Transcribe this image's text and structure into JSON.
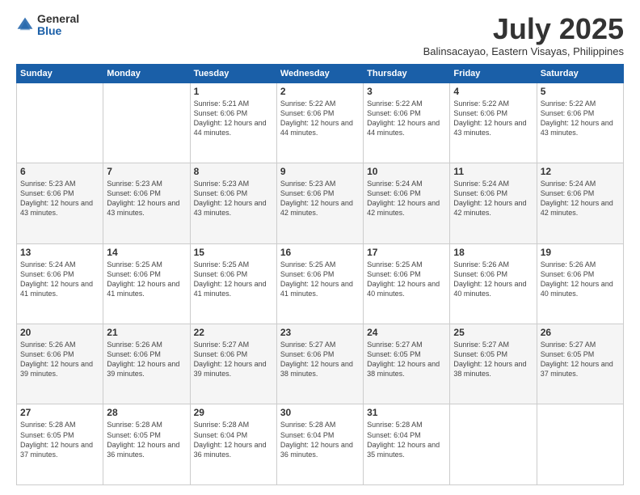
{
  "logo": {
    "general": "General",
    "blue": "Blue"
  },
  "header": {
    "month": "July 2025",
    "location": "Balinsacayao, Eastern Visayas, Philippines"
  },
  "weekdays": [
    "Sunday",
    "Monday",
    "Tuesday",
    "Wednesday",
    "Thursday",
    "Friday",
    "Saturday"
  ],
  "weeks": [
    [
      {
        "day": "",
        "sunrise": "",
        "sunset": "",
        "daylight": ""
      },
      {
        "day": "",
        "sunrise": "",
        "sunset": "",
        "daylight": ""
      },
      {
        "day": "1",
        "sunrise": "Sunrise: 5:21 AM",
        "sunset": "Sunset: 6:06 PM",
        "daylight": "Daylight: 12 hours and 44 minutes."
      },
      {
        "day": "2",
        "sunrise": "Sunrise: 5:22 AM",
        "sunset": "Sunset: 6:06 PM",
        "daylight": "Daylight: 12 hours and 44 minutes."
      },
      {
        "day": "3",
        "sunrise": "Sunrise: 5:22 AM",
        "sunset": "Sunset: 6:06 PM",
        "daylight": "Daylight: 12 hours and 44 minutes."
      },
      {
        "day": "4",
        "sunrise": "Sunrise: 5:22 AM",
        "sunset": "Sunset: 6:06 PM",
        "daylight": "Daylight: 12 hours and 43 minutes."
      },
      {
        "day": "5",
        "sunrise": "Sunrise: 5:22 AM",
        "sunset": "Sunset: 6:06 PM",
        "daylight": "Daylight: 12 hours and 43 minutes."
      }
    ],
    [
      {
        "day": "6",
        "sunrise": "Sunrise: 5:23 AM",
        "sunset": "Sunset: 6:06 PM",
        "daylight": "Daylight: 12 hours and 43 minutes."
      },
      {
        "day": "7",
        "sunrise": "Sunrise: 5:23 AM",
        "sunset": "Sunset: 6:06 PM",
        "daylight": "Daylight: 12 hours and 43 minutes."
      },
      {
        "day": "8",
        "sunrise": "Sunrise: 5:23 AM",
        "sunset": "Sunset: 6:06 PM",
        "daylight": "Daylight: 12 hours and 43 minutes."
      },
      {
        "day": "9",
        "sunrise": "Sunrise: 5:23 AM",
        "sunset": "Sunset: 6:06 PM",
        "daylight": "Daylight: 12 hours and 42 minutes."
      },
      {
        "day": "10",
        "sunrise": "Sunrise: 5:24 AM",
        "sunset": "Sunset: 6:06 PM",
        "daylight": "Daylight: 12 hours and 42 minutes."
      },
      {
        "day": "11",
        "sunrise": "Sunrise: 5:24 AM",
        "sunset": "Sunset: 6:06 PM",
        "daylight": "Daylight: 12 hours and 42 minutes."
      },
      {
        "day": "12",
        "sunrise": "Sunrise: 5:24 AM",
        "sunset": "Sunset: 6:06 PM",
        "daylight": "Daylight: 12 hours and 42 minutes."
      }
    ],
    [
      {
        "day": "13",
        "sunrise": "Sunrise: 5:24 AM",
        "sunset": "Sunset: 6:06 PM",
        "daylight": "Daylight: 12 hours and 41 minutes."
      },
      {
        "day": "14",
        "sunrise": "Sunrise: 5:25 AM",
        "sunset": "Sunset: 6:06 PM",
        "daylight": "Daylight: 12 hours and 41 minutes."
      },
      {
        "day": "15",
        "sunrise": "Sunrise: 5:25 AM",
        "sunset": "Sunset: 6:06 PM",
        "daylight": "Daylight: 12 hours and 41 minutes."
      },
      {
        "day": "16",
        "sunrise": "Sunrise: 5:25 AM",
        "sunset": "Sunset: 6:06 PM",
        "daylight": "Daylight: 12 hours and 41 minutes."
      },
      {
        "day": "17",
        "sunrise": "Sunrise: 5:25 AM",
        "sunset": "Sunset: 6:06 PM",
        "daylight": "Daylight: 12 hours and 40 minutes."
      },
      {
        "day": "18",
        "sunrise": "Sunrise: 5:26 AM",
        "sunset": "Sunset: 6:06 PM",
        "daylight": "Daylight: 12 hours and 40 minutes."
      },
      {
        "day": "19",
        "sunrise": "Sunrise: 5:26 AM",
        "sunset": "Sunset: 6:06 PM",
        "daylight": "Daylight: 12 hours and 40 minutes."
      }
    ],
    [
      {
        "day": "20",
        "sunrise": "Sunrise: 5:26 AM",
        "sunset": "Sunset: 6:06 PM",
        "daylight": "Daylight: 12 hours and 39 minutes."
      },
      {
        "day": "21",
        "sunrise": "Sunrise: 5:26 AM",
        "sunset": "Sunset: 6:06 PM",
        "daylight": "Daylight: 12 hours and 39 minutes."
      },
      {
        "day": "22",
        "sunrise": "Sunrise: 5:27 AM",
        "sunset": "Sunset: 6:06 PM",
        "daylight": "Daylight: 12 hours and 39 minutes."
      },
      {
        "day": "23",
        "sunrise": "Sunrise: 5:27 AM",
        "sunset": "Sunset: 6:06 PM",
        "daylight": "Daylight: 12 hours and 38 minutes."
      },
      {
        "day": "24",
        "sunrise": "Sunrise: 5:27 AM",
        "sunset": "Sunset: 6:05 PM",
        "daylight": "Daylight: 12 hours and 38 minutes."
      },
      {
        "day": "25",
        "sunrise": "Sunrise: 5:27 AM",
        "sunset": "Sunset: 6:05 PM",
        "daylight": "Daylight: 12 hours and 38 minutes."
      },
      {
        "day": "26",
        "sunrise": "Sunrise: 5:27 AM",
        "sunset": "Sunset: 6:05 PM",
        "daylight": "Daylight: 12 hours and 37 minutes."
      }
    ],
    [
      {
        "day": "27",
        "sunrise": "Sunrise: 5:28 AM",
        "sunset": "Sunset: 6:05 PM",
        "daylight": "Daylight: 12 hours and 37 minutes."
      },
      {
        "day": "28",
        "sunrise": "Sunrise: 5:28 AM",
        "sunset": "Sunset: 6:05 PM",
        "daylight": "Daylight: 12 hours and 36 minutes."
      },
      {
        "day": "29",
        "sunrise": "Sunrise: 5:28 AM",
        "sunset": "Sunset: 6:04 PM",
        "daylight": "Daylight: 12 hours and 36 minutes."
      },
      {
        "day": "30",
        "sunrise": "Sunrise: 5:28 AM",
        "sunset": "Sunset: 6:04 PM",
        "daylight": "Daylight: 12 hours and 36 minutes."
      },
      {
        "day": "31",
        "sunrise": "Sunrise: 5:28 AM",
        "sunset": "Sunset: 6:04 PM",
        "daylight": "Daylight: 12 hours and 35 minutes."
      },
      {
        "day": "",
        "sunrise": "",
        "sunset": "",
        "daylight": ""
      },
      {
        "day": "",
        "sunrise": "",
        "sunset": "",
        "daylight": ""
      }
    ]
  ]
}
